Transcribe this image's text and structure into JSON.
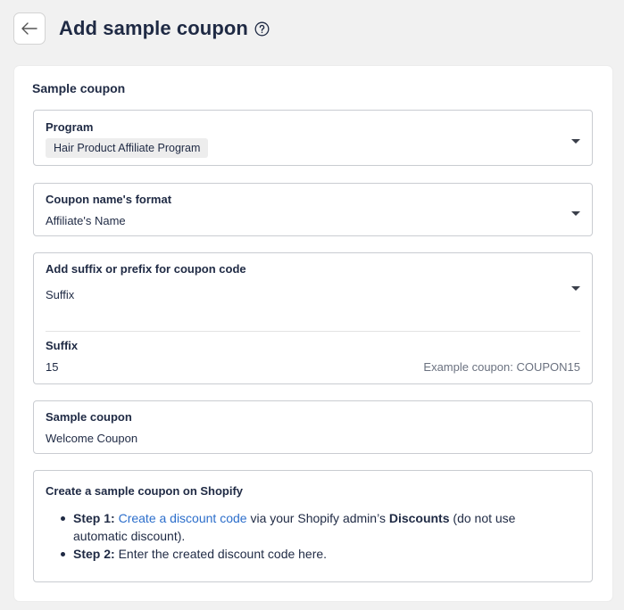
{
  "header": {
    "title": "Add sample coupon",
    "back_icon": "arrow-left-icon",
    "help_icon": "question-circle-icon"
  },
  "card": {
    "title": "Sample coupon"
  },
  "program": {
    "label": "Program",
    "value": "Hair Product Affiliate Program"
  },
  "coupon_name_format": {
    "label": "Coupon name's format",
    "value": "Affiliate's Name"
  },
  "suffix_prefix": {
    "label": "Add suffix or prefix for coupon code",
    "value": "Suffix",
    "suffix_label": "Suffix",
    "suffix_value": "15",
    "example": "Example coupon: COUPON15"
  },
  "sample_coupon": {
    "label": "Sample coupon",
    "value": "Welcome Coupon"
  },
  "info": {
    "title": "Create a sample coupon on Shopify",
    "step1_label": "Step 1:",
    "step1_link": "Create a discount code",
    "step1_text_a": "via your Shopify admin’s",
    "step1_bold": "Discounts",
    "step1_text_b": "(do not use automatic discount).",
    "step2_label": "Step 2:",
    "step2_text": "Enter the created discount code here."
  },
  "colors": {
    "text": "#1f2a44",
    "link": "#2c6ecb",
    "background": "#f1f1f1",
    "border": "#c9ccd1"
  }
}
